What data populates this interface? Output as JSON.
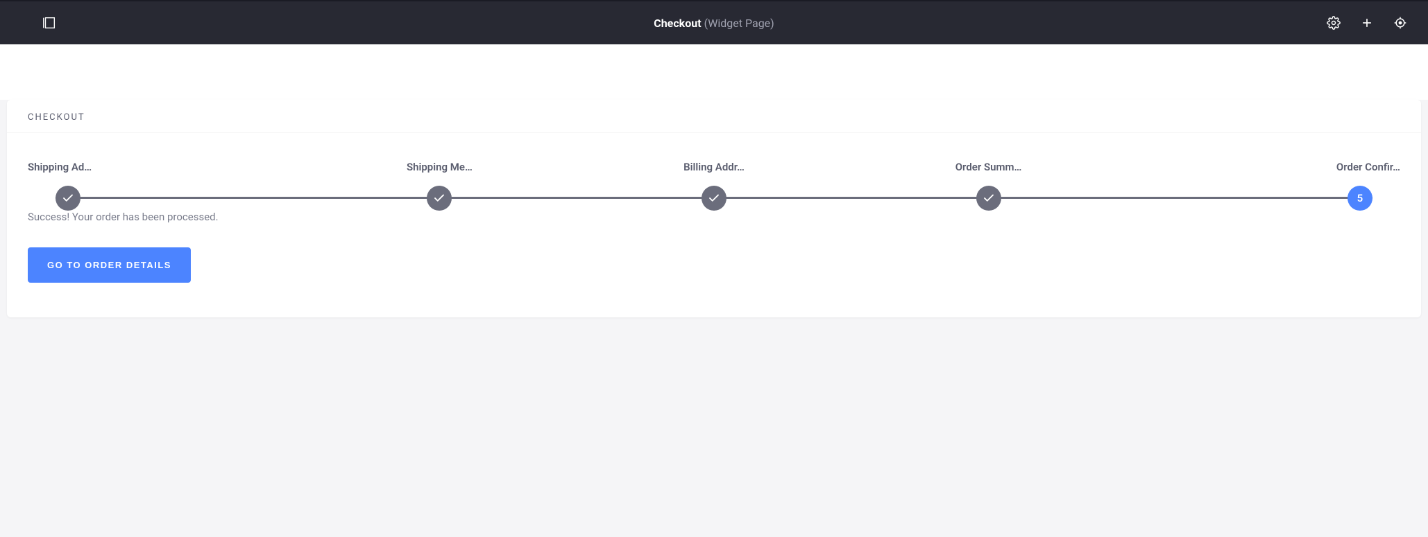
{
  "header": {
    "title": "Checkout",
    "subtitle": "(Widget Page)"
  },
  "card": {
    "header_title": "CHECKOUT"
  },
  "stepper": {
    "steps": [
      {
        "label": "Shipping Ad…",
        "state": "done"
      },
      {
        "label": "Shipping Me…",
        "state": "done"
      },
      {
        "label": "Billing Addr…",
        "state": "done"
      },
      {
        "label": "Order Summ…",
        "state": "done"
      },
      {
        "label": "Order Confir…",
        "state": "active",
        "number": "5"
      }
    ]
  },
  "content": {
    "success_message": "Success! Your order has been processed.",
    "button_label": "GO TO ORDER DETAILS"
  }
}
